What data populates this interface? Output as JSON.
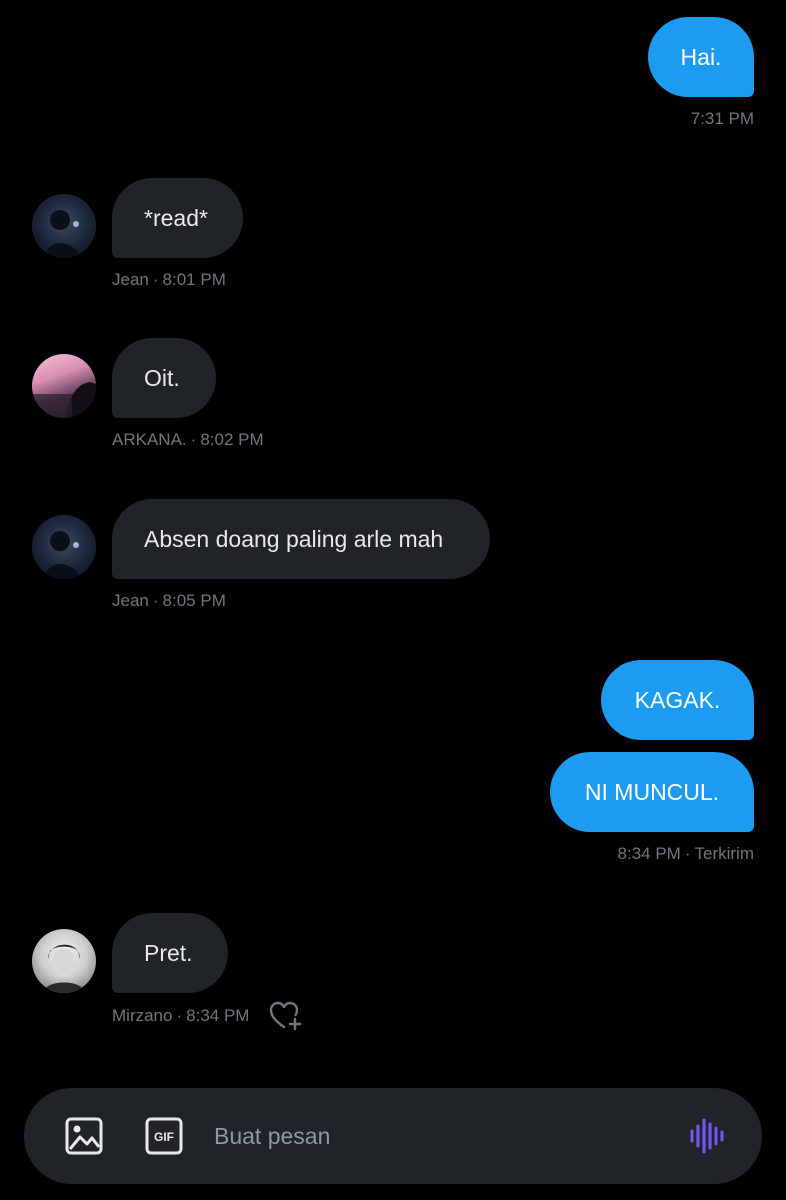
{
  "colors": {
    "background": "#000000",
    "outgoing_bubble": "#1d9bf0",
    "incoming_bubble": "#202327",
    "meta_text": "#71767b",
    "voice_accent": "#7856ff"
  },
  "messages": [
    {
      "direction": "outgoing",
      "text": "Hai.",
      "time": "7:31 PM"
    },
    {
      "direction": "incoming",
      "sender": "Jean",
      "text": "*read*",
      "time": "8:01 PM"
    },
    {
      "direction": "incoming",
      "sender": "ARKANA.",
      "text": "Oit.",
      "time": "8:02 PM"
    },
    {
      "direction": "incoming",
      "sender": "Jean",
      "text": "Absen doang paling arle mah",
      "time": "8:05 PM"
    },
    {
      "direction": "outgoing",
      "text": "KAGAK.",
      "time": ""
    },
    {
      "direction": "outgoing",
      "text": "NI MUNCUL.",
      "time": "8:34 PM",
      "status": "Terkirim"
    },
    {
      "direction": "incoming",
      "sender": "Mirzano",
      "text": "Pret.",
      "time": "8:34 PM"
    }
  ],
  "meta_separator": "·",
  "composer": {
    "placeholder": "Buat pesan",
    "gif_label": "GIF",
    "icons": [
      "image-icon",
      "gif-icon",
      "voice-message-icon"
    ]
  },
  "reaction_icon": "heart-plus-icon"
}
